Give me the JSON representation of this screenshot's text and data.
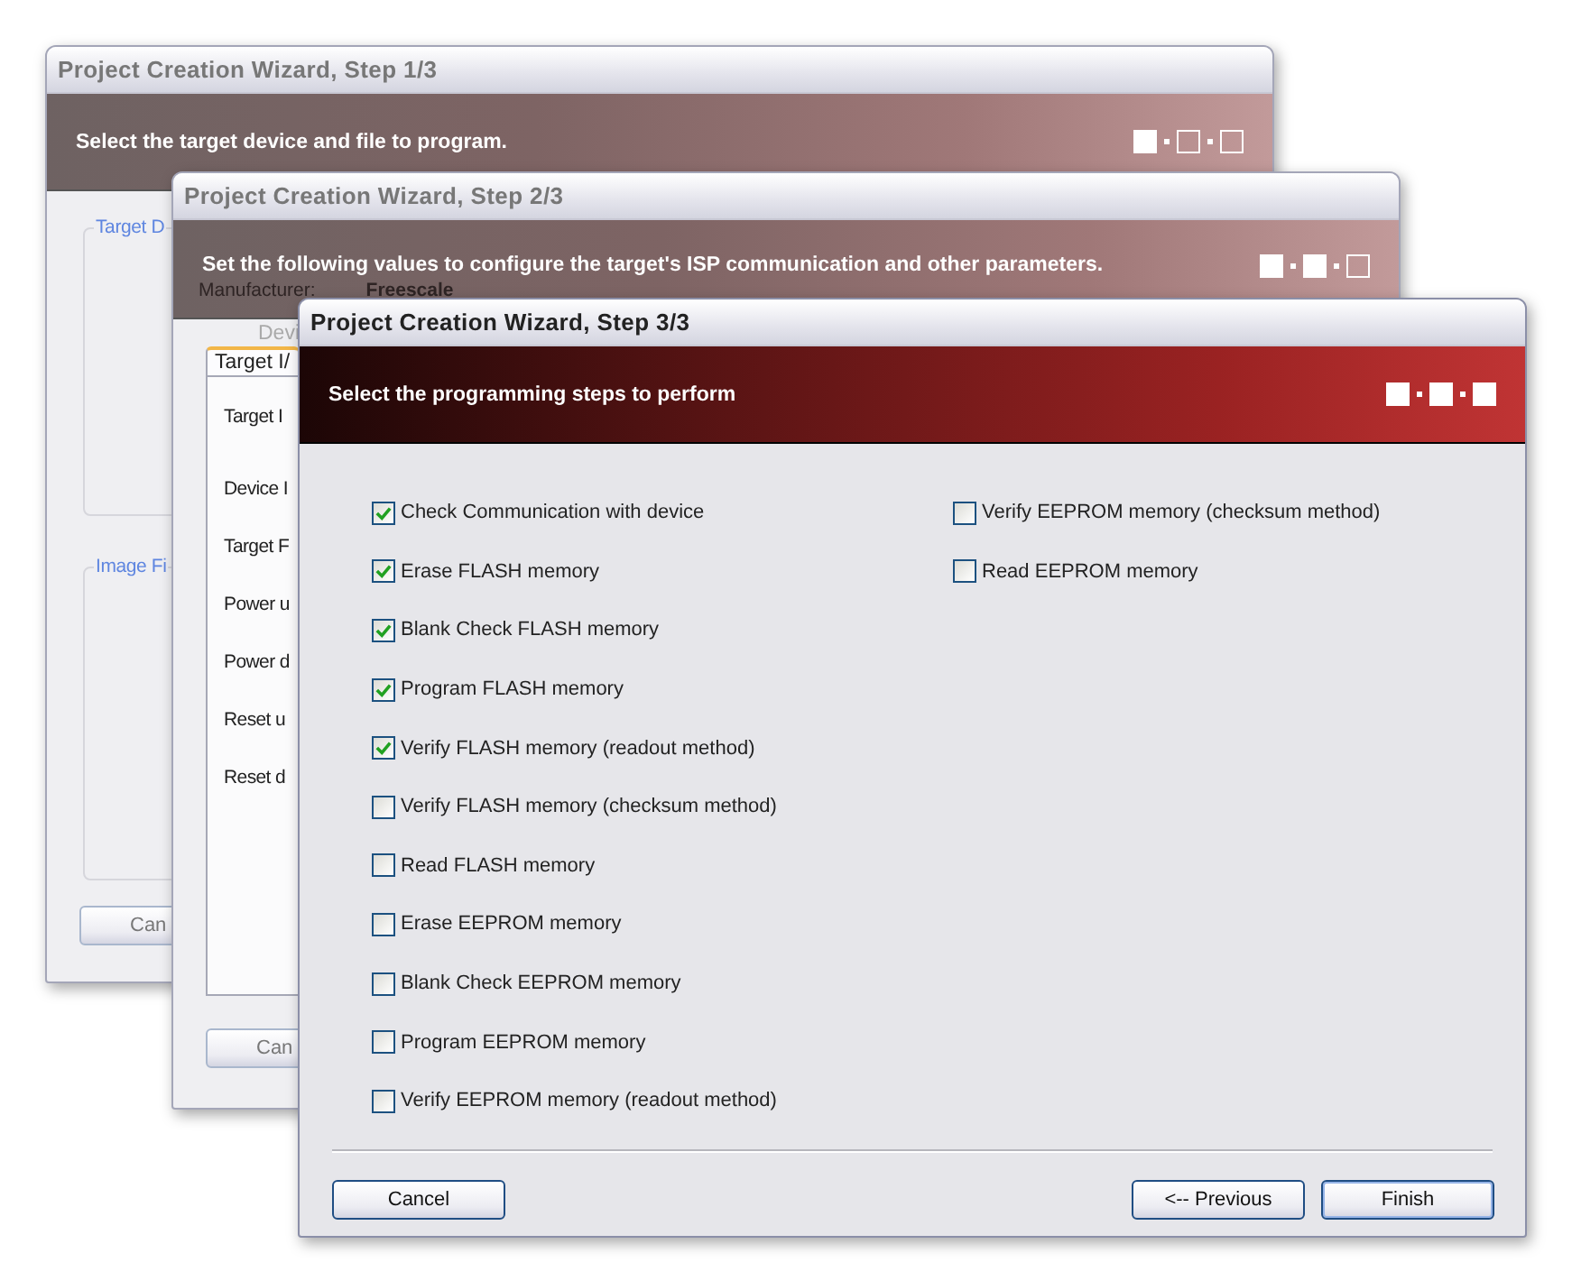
{
  "windows": [
    {
      "title": "Project Creation Wizard, Step 1/3",
      "active": false,
      "banner": "Select the target device and file to program.",
      "steps": [
        {
          "filled": true
        },
        {
          "filled": false
        },
        {
          "filled": false
        }
      ],
      "groups": [
        "Target D",
        "Image Fi"
      ],
      "buttons": [
        {
          "label": "Can",
          "kind": "cancel"
        }
      ]
    },
    {
      "title": "Project Creation Wizard, Step 2/3",
      "active": false,
      "banner": "Set the following values to configure the target's ISP communication and other parameters.",
      "banner_ghost": [
        "Manufacturer:",
        "Freescale"
      ],
      "steps": [
        {
          "filled": true
        },
        {
          "filled": true
        },
        {
          "filled": false
        }
      ],
      "caption": "Devi",
      "tab": {
        "label": "Target I/",
        "selected": true
      },
      "field_labels": [
        "Target I",
        "Device I",
        "Target F",
        "Power u",
        "Power d",
        "Reset u",
        "Reset d"
      ],
      "buttons": [
        {
          "label": "Can",
          "kind": "cancel"
        }
      ]
    },
    {
      "title": "Project Creation Wizard, Step 3/3",
      "active": true,
      "banner": "Select the programming steps to perform",
      "steps": [
        {
          "filled": true
        },
        {
          "filled": true
        },
        {
          "filled": true
        }
      ],
      "checkboxes": [
        {
          "label": "Check Communication with device",
          "checked": true
        },
        {
          "label": "Erase FLASH memory",
          "checked": true
        },
        {
          "label": "Blank Check FLASH memory",
          "checked": true
        },
        {
          "label": "Program FLASH memory",
          "checked": true
        },
        {
          "label": "Verify FLASH memory (readout method)",
          "checked": true
        },
        {
          "label": "Verify FLASH memory (checksum method)",
          "checked": false
        },
        {
          "label": "Read FLASH memory",
          "checked": false
        },
        {
          "label": "Erase EEPROM memory",
          "checked": false
        },
        {
          "label": "Blank Check EEPROM memory",
          "checked": false
        },
        {
          "label": "Program EEPROM memory",
          "checked": false
        },
        {
          "label": "Verify EEPROM memory (readout method)",
          "checked": false
        },
        {
          "label": "Verify EEPROM memory (checksum method)",
          "checked": false
        },
        {
          "label": "Read EEPROM memory",
          "checked": false
        }
      ],
      "buttons": [
        {
          "label": "Cancel",
          "kind": "cancel"
        },
        {
          "label": "<-- Previous",
          "kind": "nav"
        },
        {
          "label": "Finish",
          "kind": "default"
        }
      ]
    }
  ]
}
